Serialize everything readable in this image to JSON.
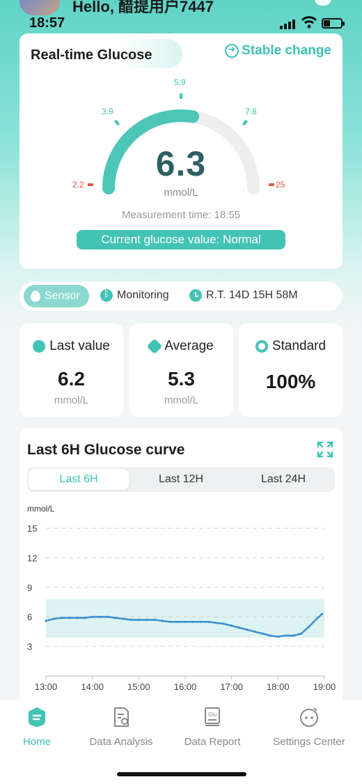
{
  "status_bar": {
    "time": "18:57",
    "greeting": "Hello, 醋提用户7447"
  },
  "glucose_card": {
    "title": "Real-time Glucose",
    "trend_label": "Stable change",
    "value": "6.3",
    "unit": "mmol/L",
    "measurement_time": "Measurement time: 18:55",
    "status_pill": "Current glucose value: Normal",
    "gauge_ticks": {
      "min": "2.2",
      "low": "3.9",
      "mid": "5.9",
      "high": "7.8",
      "max": "25"
    },
    "gauge_fill_value": 6.3,
    "gauge_range": [
      2.2,
      25
    ],
    "colors": {
      "accent": "#43c3b4",
      "track": "#eeeeee",
      "limit": "#e2553e"
    }
  },
  "sensor_bar": {
    "sensor_label": "Sensor",
    "monitoring_label": "Monitoring",
    "remaining_time": "R.T. 14D 15H 58M"
  },
  "stats": [
    {
      "title": "Last value",
      "value": "6.2",
      "unit": "mmol/L",
      "icon": "clock-icon"
    },
    {
      "title": "Average",
      "value": "5.3",
      "unit": "mmol/L",
      "icon": "average-icon"
    },
    {
      "title": "Standard",
      "value": "100%",
      "unit": "",
      "icon": "target-icon"
    }
  ],
  "curve_card": {
    "title": "Last 6H Glucose curve",
    "tabs": [
      "Last 6H",
      "Last 12H",
      "Last 24H"
    ],
    "active_tab": "Last 6H"
  },
  "chart_data": {
    "type": "line",
    "ylabel": "mmol/L",
    "ylim": [
      0,
      15
    ],
    "yticks": [
      "15",
      "12",
      "9",
      "6",
      "3"
    ],
    "x_ticks": [
      "13:00",
      "14:00",
      "15:00",
      "16:00",
      "17:00",
      "18:00",
      "19:00"
    ],
    "target_band": [
      3.9,
      7.8
    ],
    "grid": true,
    "series": [
      {
        "x": [
          "13:00",
          "13:10",
          "13:20",
          "13:30",
          "13:40",
          "13:50",
          "14:00",
          "14:10",
          "14:20",
          "14:30",
          "14:40",
          "14:50",
          "15:00",
          "15:10",
          "15:20",
          "15:30",
          "15:40",
          "15:50",
          "16:00",
          "16:10",
          "16:20",
          "16:30",
          "16:40",
          "16:50",
          "17:00",
          "17:10",
          "17:20",
          "17:30",
          "17:40",
          "17:50",
          "18:00",
          "18:10",
          "18:20",
          "18:30",
          "18:40",
          "18:50",
          "18:57"
        ],
        "values": [
          5.6,
          5.8,
          5.9,
          5.9,
          5.9,
          5.9,
          6.0,
          6.0,
          6.0,
          5.9,
          5.8,
          5.7,
          5.7,
          5.7,
          5.7,
          5.6,
          5.5,
          5.5,
          5.5,
          5.5,
          5.5,
          5.5,
          5.4,
          5.3,
          5.1,
          4.9,
          4.7,
          4.5,
          4.3,
          4.1,
          4.0,
          4.1,
          4.1,
          4.3,
          5.0,
          5.8,
          6.3
        ]
      }
    ]
  },
  "bottom_nav": {
    "items": [
      {
        "label": "Home",
        "icon": "home-icon"
      },
      {
        "label": "Data Analysis",
        "icon": "data-analysis-icon"
      },
      {
        "label": "Data Report",
        "icon": "data-report-icon"
      },
      {
        "label": "Settings Center",
        "icon": "settings-center-icon"
      }
    ],
    "active": "Home"
  }
}
